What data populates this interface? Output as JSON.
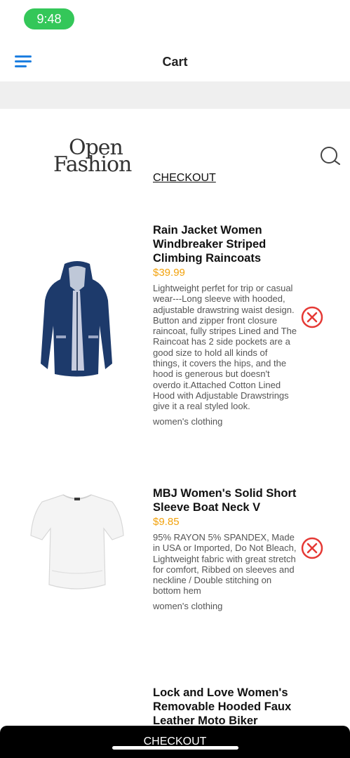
{
  "status_bar": {
    "time": "9:48"
  },
  "header": {
    "title": "Cart",
    "menu_icon": "hamburger-menu-icon"
  },
  "brand": {
    "logo_line1": "Open",
    "logo_line2": "Fashion",
    "search_icon": "search-icon"
  },
  "checkout_link": "CHECKOUT",
  "products": [
    {
      "title": "Rain Jacket Women Windbreaker Striped Climbing Raincoats",
      "price": "$39.99",
      "description": "Lightweight perfet for trip or casual wear---Long sleeve with hooded, adjustable drawstring waist design. Button and zipper front closure raincoat, fully stripes Lined and The Raincoat has 2 side pockets are a good size to hold all kinds of things, it covers the hips, and the hood is generous but doesn't overdo it.Attached Cotton Lined Hood with Adjustable Drawstrings give it a real styled look.",
      "category": "women's clothing"
    },
    {
      "title": "MBJ Women's Solid Short Sleeve Boat Neck V",
      "price": "$9.85",
      "description": "95% RAYON 5% SPANDEX, Made in USA or Imported, Do Not Bleach, Lightweight fabric with great stretch for comfort, Ribbed on sleeves and neckline / Double stitching on bottom hem",
      "category": "women's clothing"
    },
    {
      "title": "Lock and Love Women's Removable Hooded Faux Leather Moto Biker"
    }
  ],
  "bottom_bar": {
    "label": "CHECKOUT"
  },
  "colors": {
    "price": "#f2a20c",
    "remove": "#e53935",
    "menu": "#1e7fe0",
    "status": "#34c759"
  }
}
